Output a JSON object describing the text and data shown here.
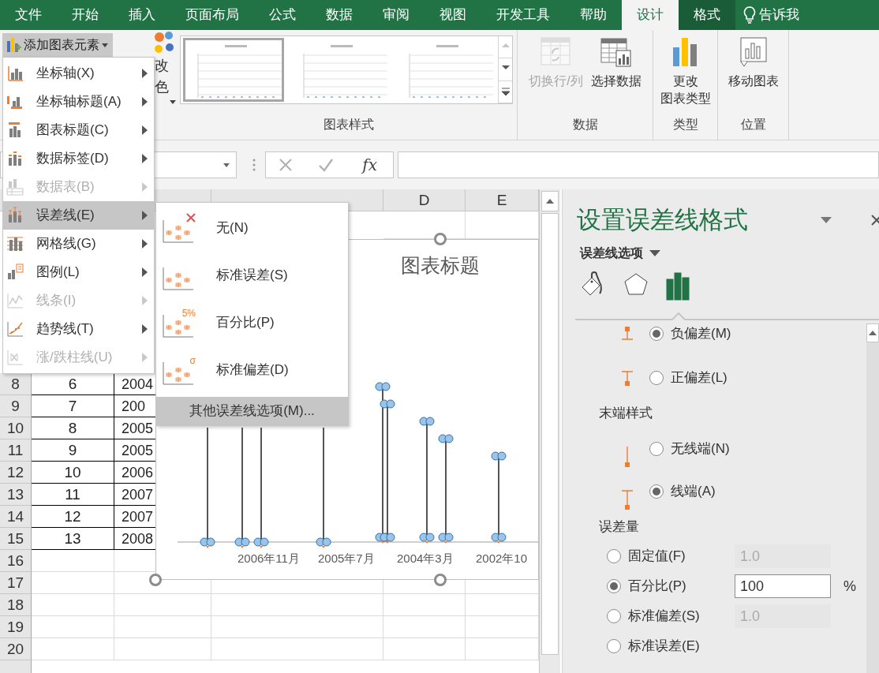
{
  "ribbon_tabs": [
    {
      "label": "文件",
      "selected": false,
      "contextual": false
    },
    {
      "label": "开始",
      "selected": false,
      "contextual": false
    },
    {
      "label": "插入",
      "selected": false,
      "contextual": false
    },
    {
      "label": "页面布局",
      "selected": false,
      "contextual": false
    },
    {
      "label": "公式",
      "selected": false,
      "contextual": false
    },
    {
      "label": "数据",
      "selected": false,
      "contextual": false
    },
    {
      "label": "审阅",
      "selected": false,
      "contextual": false
    },
    {
      "label": "视图",
      "selected": false,
      "contextual": false
    },
    {
      "label": "开发工具",
      "selected": false,
      "contextual": false
    },
    {
      "label": "帮助",
      "selected": false,
      "contextual": false
    },
    {
      "label": "设计",
      "selected": true,
      "contextual": true
    },
    {
      "label": "格式",
      "selected": false,
      "contextual": true
    }
  ],
  "tell_me": "告诉我",
  "ribbon": {
    "add_element": "添加图表元素",
    "change_colors": [
      "改",
      "色"
    ],
    "gallery": [
      {
        "selected": true
      },
      {
        "selected": false
      },
      {
        "selected": false
      }
    ],
    "gallery_label": "图表样式",
    "groups": [
      {
        "label": "数据",
        "buttons": [
          {
            "label": "切换行/列",
            "disabled": true
          },
          {
            "label": "选择数据",
            "disabled": false
          }
        ]
      },
      {
        "label": "类型",
        "buttons": [
          {
            "lines": [
              "更改",
              "图表类型"
            ],
            "disabled": false
          }
        ]
      },
      {
        "label": "位置",
        "buttons": [
          {
            "label": "移动图表",
            "disabled": false
          }
        ]
      }
    ]
  },
  "formula_bar": {
    "function_label": "fx"
  },
  "sheet": {
    "columns": [
      "D",
      "E"
    ],
    "rows": [
      {
        "header": "8",
        "cells": [
          "6",
          "2004"
        ]
      },
      {
        "header": "9",
        "cells": [
          "7",
          "200"
        ]
      },
      {
        "header": "10",
        "cells": [
          "8",
          "2005"
        ]
      },
      {
        "header": "11",
        "cells": [
          "9",
          "2005"
        ]
      },
      {
        "header": "12",
        "cells": [
          "10",
          "2006"
        ]
      },
      {
        "header": "13",
        "cells": [
          "11",
          "2007"
        ]
      },
      {
        "header": "14",
        "cells": [
          "12",
          "2007"
        ]
      },
      {
        "header": "15",
        "cells": [
          "13",
          "2008"
        ]
      },
      {
        "header": "16",
        "cells": []
      },
      {
        "header": "17",
        "cells": []
      },
      {
        "header": "18",
        "cells": []
      },
      {
        "header": "19",
        "cells": []
      },
      {
        "header": "20",
        "cells": []
      }
    ]
  },
  "chart": {
    "title": "图表标题",
    "axis_labels": [
      "2006年11月",
      "2005年7月",
      "2004年3月",
      "2002年10"
    ]
  },
  "menu": {
    "items": [
      {
        "label": "坐标轴(X)",
        "disabled": false,
        "selected": false
      },
      {
        "label": "坐标轴标题(A)",
        "disabled": false,
        "selected": false
      },
      {
        "label": "图表标题(C)",
        "disabled": false,
        "selected": false
      },
      {
        "label": "数据标签(D)",
        "disabled": false,
        "selected": false
      },
      {
        "label": "数据表(B)",
        "disabled": true,
        "selected": false
      },
      {
        "label": "误差线(E)",
        "disabled": false,
        "selected": true
      },
      {
        "label": "网格线(G)",
        "disabled": false,
        "selected": false
      },
      {
        "label": "图例(L)",
        "disabled": false,
        "selected": false
      },
      {
        "label": "线条(I)",
        "disabled": true,
        "selected": false
      },
      {
        "label": "趋势线(T)",
        "disabled": false,
        "selected": false
      },
      {
        "label": "涨/跌柱线(U)",
        "disabled": true,
        "selected": false
      }
    ]
  },
  "submenu": {
    "items": [
      {
        "label": "无(N)",
        "kind": "none",
        "selected": false
      },
      {
        "label": "标准误差(S)",
        "kind": "plain",
        "selected": false
      },
      {
        "label": "百分比(P)",
        "kind": "tagged",
        "icon_text": "5%",
        "selected": false
      },
      {
        "label": "标准偏差(D)",
        "kind": "tagged",
        "icon_text": "σ",
        "selected": false
      }
    ],
    "more": {
      "label": "其他误差线选项(M)...",
      "selected": true
    }
  },
  "panel": {
    "title": "设置误差线格式",
    "section": "误差线选项",
    "tabs": [
      {
        "selected": false
      },
      {
        "selected": false
      },
      {
        "selected": true
      }
    ],
    "direction": [
      {
        "label": "负偏差(M)",
        "selected": true
      },
      {
        "label": "正偏差(L)",
        "selected": false
      }
    ],
    "end_style_heading": "末端样式",
    "end_style": [
      {
        "label": "无线端(N)",
        "selected": false
      },
      {
        "label": "线端(A)",
        "selected": true
      }
    ],
    "amount_heading": "误差量",
    "amount": [
      {
        "label": "固定值(F)",
        "selected": false,
        "value": "1.0"
      },
      {
        "label": "百分比(P)",
        "selected": true,
        "value": "100",
        "unit": "%"
      },
      {
        "label": "标准偏差(S)",
        "selected": false,
        "value": "1.0"
      },
      {
        "label": "标准误差(E)",
        "selected": false
      }
    ]
  }
}
